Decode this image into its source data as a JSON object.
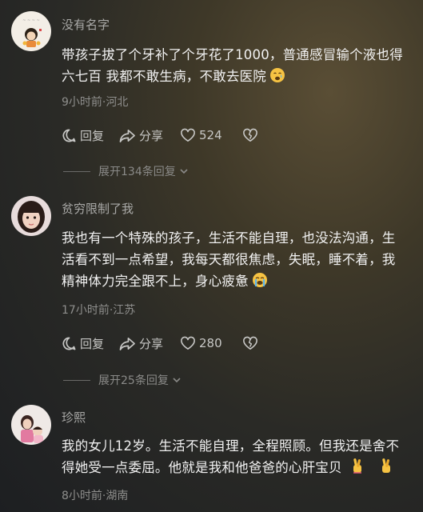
{
  "comments": [
    {
      "username": "没有名字",
      "content_lines": [
        "带孩子拔了个牙补了个牙花了1000，普通感冒输个液也得",
        "六七百 我都不敢生病，不敢去医院"
      ],
      "emoji": "crying-face-emoji",
      "meta": "9小时前·河北",
      "reply_label": "回复",
      "share_label": "分享",
      "like_count": "524",
      "expand_label": "展开134条回复"
    },
    {
      "username": "贫穷限制了我",
      "content_lines": [
        "我也有一个特殊的孩子，生活不能自理，也没法沟通，生",
        "活看不到一点希望，我每天都很焦虑，失眠，睡不着，我",
        "精神体力完全跟不上，身心疲惫"
      ],
      "emoji": "loudly-crying-face-emoji",
      "meta": "17小时前·江苏",
      "reply_label": "回复",
      "share_label": "分享",
      "like_count": "280",
      "expand_label": "展开25条回复"
    },
    {
      "username": "珍熙",
      "content_lines": [
        "我的女儿12岁。生活不能自理，全程照顾。但我还是舍不",
        "得她受一点委屈。他就是我和他爸爸的心肝宝贝"
      ],
      "emoji": "fingers-crossed-emoji",
      "meta": "8小时前·湖南"
    }
  ],
  "colors": {
    "text_primary": "#f1f1f1",
    "text_secondary": "#a9a9a7",
    "text_meta": "#8e8e8c",
    "emoji_yellow": "#f6c343"
  }
}
